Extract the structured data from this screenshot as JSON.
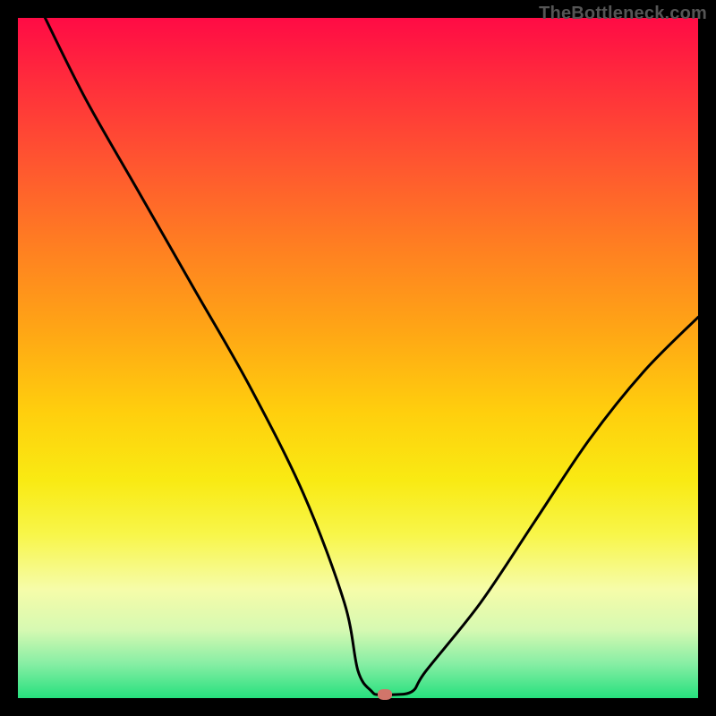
{
  "watermark": "TheBottleneck.com",
  "chart_data": {
    "type": "line",
    "title": "",
    "xlabel": "",
    "ylabel": "",
    "xlim": [
      0,
      100
    ],
    "ylim": [
      0,
      100
    ],
    "series": [
      {
        "name": "bottleneck-curve",
        "x": [
          4,
          10,
          18,
          26,
          34,
          42,
          48,
          50,
          52,
          53,
          55,
          58,
          60,
          68,
          76,
          84,
          92,
          100
        ],
        "y": [
          100,
          88,
          74,
          60,
          46,
          30,
          14,
          4,
          1,
          0.5,
          0.5,
          1,
          4,
          14,
          26,
          38,
          48,
          56
        ]
      }
    ],
    "marker": {
      "x": 54,
      "y": 0.5
    },
    "colors": {
      "curve": "#000000",
      "marker": "#d1756a",
      "gradient_top": "#ff0b45",
      "gradient_bottom": "#26e07e"
    }
  }
}
